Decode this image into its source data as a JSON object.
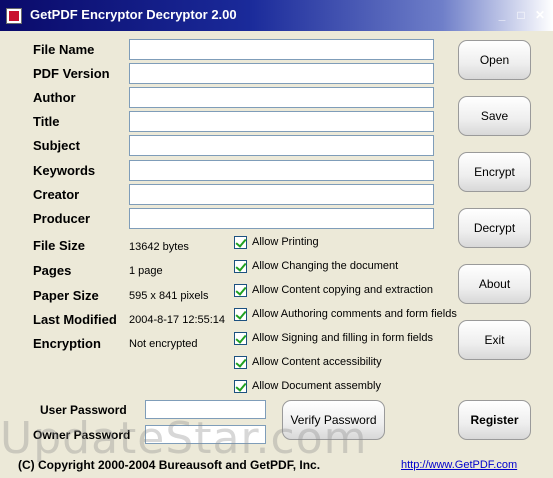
{
  "window": {
    "title": "GetPDF Encryptor Decryptor 2.00",
    "controls": {
      "minimize": "_",
      "maximize": "□",
      "close": "✕"
    }
  },
  "info_fields": {
    "file_name": {
      "label": "File Name",
      "value": ""
    },
    "pdf_version": {
      "label": "PDF Version",
      "value": ""
    },
    "author": {
      "label": "Author",
      "value": ""
    },
    "title": {
      "label": "Title",
      "value": ""
    },
    "subject": {
      "label": "Subject",
      "value": ""
    },
    "keywords": {
      "label": "Keywords",
      "value": ""
    },
    "creator": {
      "label": "Creator",
      "value": ""
    },
    "producer": {
      "label": "Producer",
      "value": ""
    }
  },
  "properties": {
    "file_size": {
      "label": "File Size",
      "value": "13642 bytes"
    },
    "pages": {
      "label": "Pages",
      "value": "1 page"
    },
    "paper_size": {
      "label": "Paper Size",
      "value": "595 x 841 pixels"
    },
    "last_modified": {
      "label": "Last Modified",
      "value": "2004-8-17 12:55:14"
    },
    "encryption": {
      "label": "Encryption",
      "value": "Not encrypted"
    }
  },
  "permissions": [
    {
      "label": "Allow Printing",
      "checked": true
    },
    {
      "label": "Allow Changing the document",
      "checked": true
    },
    {
      "label": "Allow Content copying and extraction",
      "checked": true
    },
    {
      "label": "Allow Authoring comments and form fields",
      "checked": true
    },
    {
      "label": "Allow Signing and filling in form fields",
      "checked": true
    },
    {
      "label": "Allow Content accessibility",
      "checked": true
    },
    {
      "label": "Allow Document assembly",
      "checked": true
    }
  ],
  "buttons": {
    "open": "Open",
    "save": "Save",
    "encrypt": "Encrypt",
    "decrypt": "Decrypt",
    "about": "About",
    "exit": "Exit",
    "register": "Register",
    "verify_password": "Verify Password"
  },
  "passwords": {
    "user_label": "User Password",
    "owner_label": "Owner Password",
    "user_value": "",
    "owner_value": ""
  },
  "footer": {
    "copyright": "(C) Copyright 2000-2004 Bureausoft and GetPDF, Inc.",
    "link": "http://www.GetPDF.com"
  },
  "watermark": "UpdateStar.com",
  "colors": {
    "titlebar_dark": "#0a0a6a",
    "window_bg": "#ece9d8",
    "link": "#0000cc",
    "check": "#21a121"
  }
}
